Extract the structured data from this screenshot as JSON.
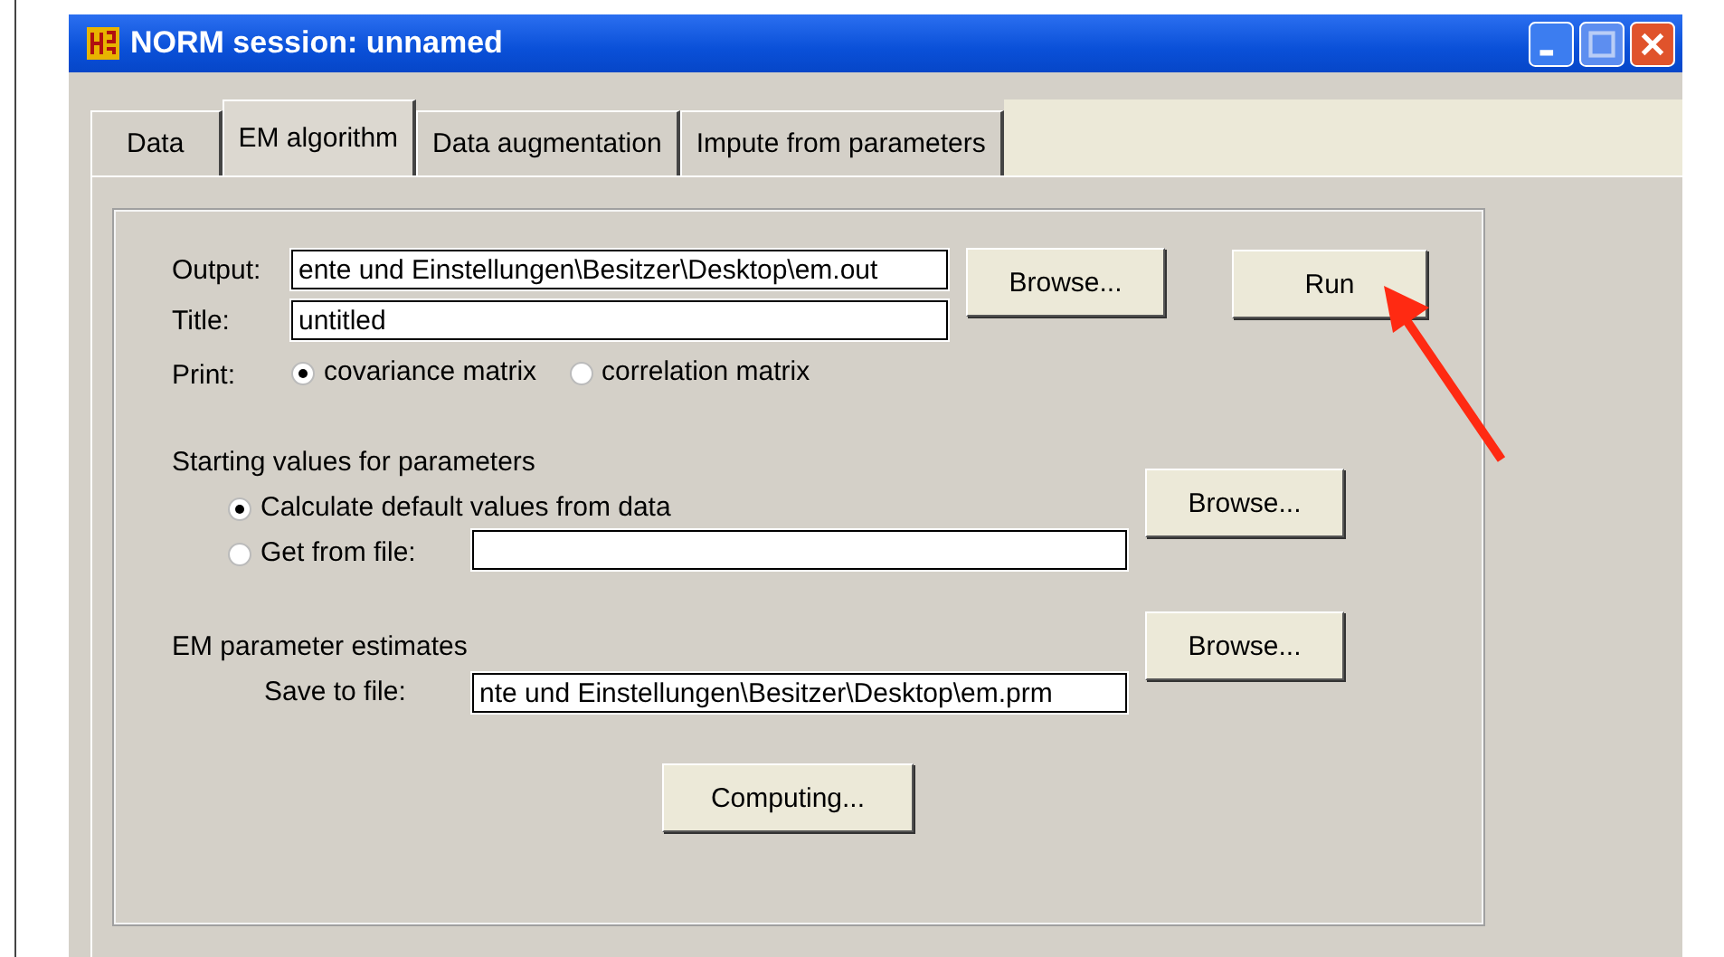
{
  "window": {
    "title": "NORM session: unnamed"
  },
  "tabs": [
    {
      "label": "Data",
      "selected": false
    },
    {
      "label": "EM algorithm",
      "selected": true
    },
    {
      "label": "Data augmentation",
      "selected": false
    },
    {
      "label": "Impute from parameters",
      "selected": false
    }
  ],
  "output": {
    "label": "Output:",
    "value": "ente und Einstellungen\\Besitzer\\Desktop\\em.out",
    "browse": "Browse..."
  },
  "run_button": "Run",
  "title_field": {
    "label": "Title:",
    "value": "untitled"
  },
  "print": {
    "label": "Print:",
    "options": [
      {
        "label": "covariance matrix",
        "selected": true
      },
      {
        "label": "correlation matrix",
        "selected": false
      }
    ]
  },
  "starting_values": {
    "heading": "Starting values for parameters",
    "options": [
      {
        "label": "Calculate default values from data",
        "selected": true
      },
      {
        "label": "Get from file:",
        "selected": false
      }
    ],
    "browse": "Browse..."
  },
  "em_estimates": {
    "heading": "EM parameter estimates",
    "label": "Save to file:",
    "value": "nte und Einstellungen\\Besitzer\\Desktop\\em.prm",
    "browse": "Browse..."
  },
  "computing_button": "Computing..."
}
